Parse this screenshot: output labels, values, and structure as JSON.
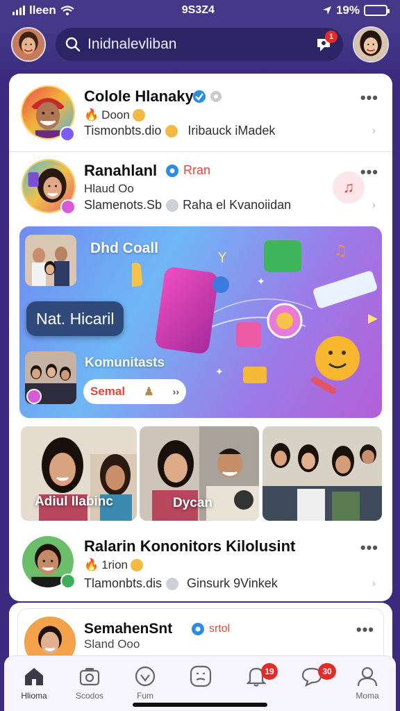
{
  "status_bar": {
    "carrier": "lleen",
    "time": "9S3Z4",
    "battery": "19%"
  },
  "header": {
    "search_placeholder": "Inidnalevliban",
    "notification_badge": "1"
  },
  "posts": [
    {
      "name": "Colole Hlanaky",
      "meta": "Doon",
      "line_left": "Tismonbts.dio",
      "line_right": "Iribauck iMadek"
    },
    {
      "name": "Ranahlanl",
      "name_tag": "Rran",
      "meta": "Hlaud Oo",
      "line_left": "Slamenots.Sb",
      "line_right": "Raha el Kvanoiidan"
    }
  ],
  "banner": {
    "title_top": "Dhd Coall",
    "chip": "Nat. Hicaril",
    "title_bottom": "Komunitasts",
    "send_label": "Semal",
    "send_arrows": "››"
  },
  "strip": {
    "labels": [
      "Adiul Ilabinc",
      "Dycan"
    ]
  },
  "post3": {
    "name": "Ralarin Kononitors Kilolusint",
    "meta": "1rion",
    "line_left": "Tlamonbts.dis",
    "line_right": "Ginsurk 9Vinkek"
  },
  "post4": {
    "name": "SemahenSnt",
    "name_tag": "srtol",
    "meta": "Sland Ooo"
  },
  "bottom_nav": {
    "items": [
      {
        "label": "Hlioma",
        "icon": "home-icon"
      },
      {
        "label": "Scodos",
        "icon": "camera-icon"
      },
      {
        "label": "Fum",
        "icon": "heart-icon"
      },
      {
        "label": "",
        "icon": "face-icon"
      },
      {
        "label": "",
        "icon": "bell-icon",
        "badge": "19"
      },
      {
        "label": "",
        "icon": "chat-icon",
        "badge": "30"
      },
      {
        "label": "Moma",
        "icon": "profile-icon"
      }
    ]
  },
  "colors": {
    "header_bg": "#46398a",
    "accent_red": "#e52a2a",
    "verified_blue": "#2a8ce5",
    "banner_gradient_start": "#6f8bf0",
    "banner_gradient_end": "#b35fd8"
  }
}
